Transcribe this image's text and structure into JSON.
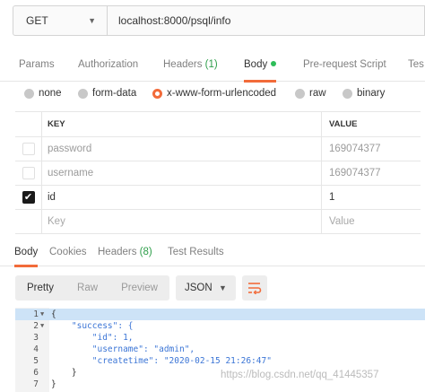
{
  "request": {
    "method": "GET",
    "url": "localhost:8000/psql/info"
  },
  "request_tabs": [
    {
      "label": "Params"
    },
    {
      "label": "Authorization"
    },
    {
      "label": "Headers",
      "count": "(1)"
    },
    {
      "label": "Body"
    },
    {
      "label": "Pre-request Script"
    },
    {
      "label": "Tes"
    }
  ],
  "body_types": [
    "none",
    "form-data",
    "x-www-form-urlencoded",
    "raw",
    "binary"
  ],
  "body_selected": "x-www-form-urlencoded",
  "params": {
    "key_header": "KEY",
    "value_header": "VALUE",
    "rows": [
      {
        "key": "password",
        "value": "169074377",
        "checked": false
      },
      {
        "key": "username",
        "value": "169074377",
        "checked": false
      },
      {
        "key": "id",
        "value": "1",
        "checked": true
      }
    ],
    "placeholder": {
      "key": "Key",
      "value": "Value"
    }
  },
  "response_tabs": [
    {
      "label": "Body"
    },
    {
      "label": "Cookies"
    },
    {
      "label": "Headers",
      "count": "(8)"
    },
    {
      "label": "Test Results"
    }
  ],
  "view_modes": [
    "Pretty",
    "Raw",
    "Preview"
  ],
  "format": "JSON",
  "code": {
    "lines": [
      {
        "n": "1",
        "text": "{"
      },
      {
        "n": "2",
        "text": "    \"success\": {"
      },
      {
        "n": "3",
        "text": "        \"id\": 1,"
      },
      {
        "n": "4",
        "text": "        \"username\": \"admin\","
      },
      {
        "n": "5",
        "text": "        \"createtime\": \"2020-02-15 21:26:47\""
      },
      {
        "n": "6",
        "text": "    }"
      },
      {
        "n": "7",
        "text": "}"
      }
    ]
  },
  "watermark": "https://blog.csdn.net/qq_41445357",
  "colors": {
    "accent": "#f26b3a",
    "count": "#2e9e4a",
    "json_key": "#3b75d6"
  },
  "icons": {
    "wrap": "wrap-lines-icon",
    "check": "checkmark-icon"
  }
}
